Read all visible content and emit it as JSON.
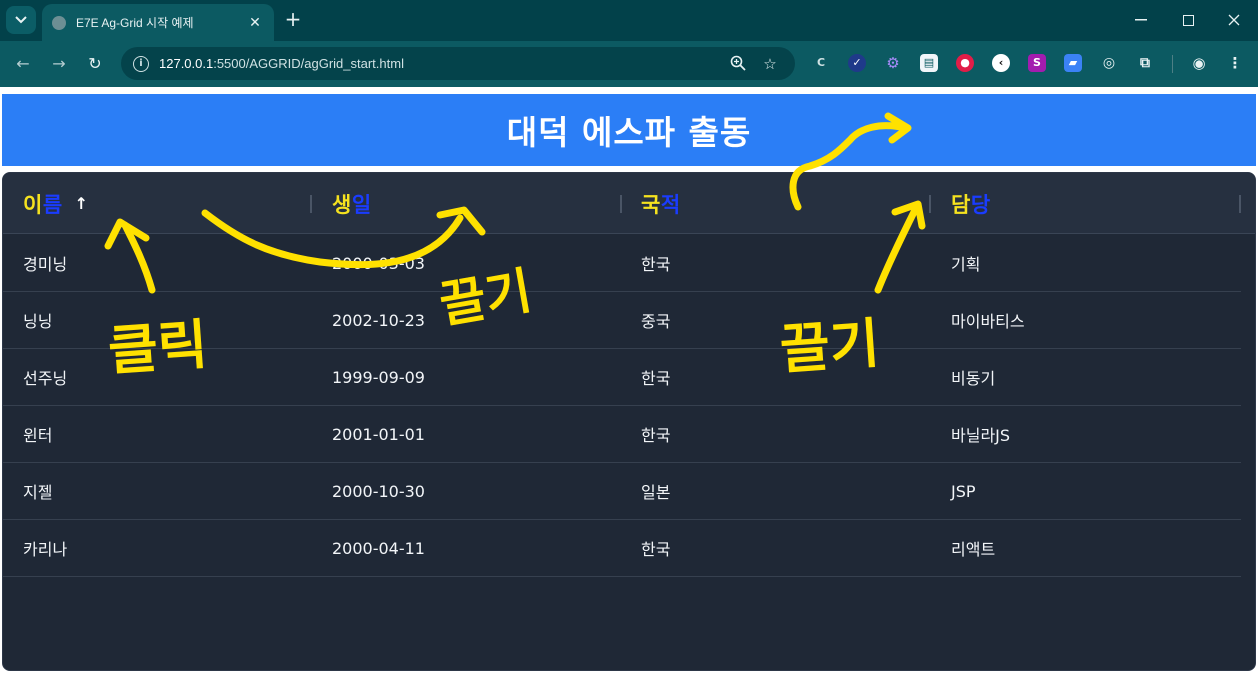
{
  "browser": {
    "tab_title": "E7E Ag-Grid 시작 예제",
    "url_host": "127.0.0.1",
    "url_rest": ":5500/AGGRID/agGrid_start.html",
    "colors": {
      "frame": "#02414a",
      "toolbar": "#0c5a62"
    }
  },
  "page": {
    "heading": "대덕 에스파 출동",
    "colors": {
      "banner": "#2b7ef6",
      "grid_bg": "#1f2836",
      "grid_header": "#263040"
    }
  },
  "grid": {
    "columns": [
      {
        "label": "이름",
        "sort": "ascending"
      },
      {
        "label": "생일"
      },
      {
        "label": "국적"
      },
      {
        "label": "담당"
      }
    ],
    "header_letter_colors": [
      "#f5e21f",
      "#1a3cff"
    ],
    "rows": [
      {
        "name": "경미닝",
        "birth": "2000-03-03",
        "country": "한국",
        "role": "기획"
      },
      {
        "name": "닝닝",
        "birth": "2002-10-23",
        "country": "중국",
        "role": "마이바티스"
      },
      {
        "name": "선주닝",
        "birth": "1999-09-09",
        "country": "한국",
        "role": "비동기"
      },
      {
        "name": "윈터",
        "birth": "2001-01-01",
        "country": "한국",
        "role": "바닐라JS"
      },
      {
        "name": "지젤",
        "birth": "2000-10-30",
        "country": "일본",
        "role": "JSP"
      },
      {
        "name": "카리나",
        "birth": "2000-04-11",
        "country": "한국",
        "role": "리액트"
      }
    ]
  },
  "annotations": {
    "color": "#ffe100",
    "click_label": "클릭",
    "drag_label": "끌기"
  }
}
